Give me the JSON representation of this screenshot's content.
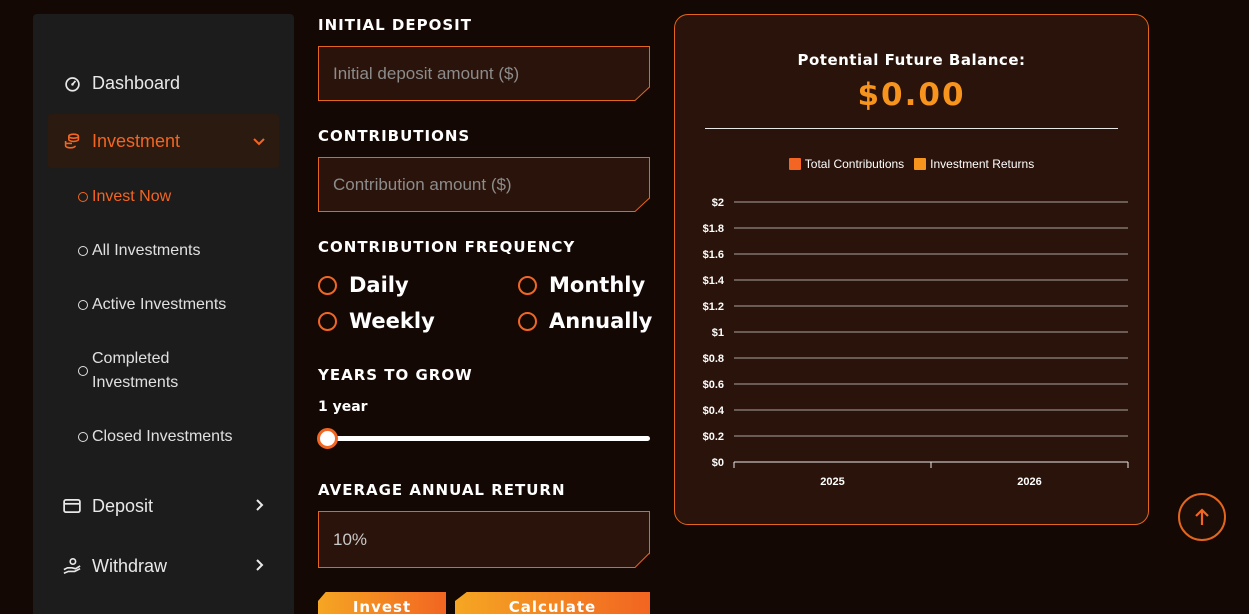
{
  "sidebar": {
    "items": [
      {
        "label": "Dashboard",
        "icon": "gauge-icon"
      },
      {
        "label": "Investment",
        "icon": "coins-icon",
        "active": true,
        "expanded": true
      },
      {
        "label": "Deposit",
        "icon": "card-icon"
      },
      {
        "label": "Withdraw",
        "icon": "withdraw-icon"
      }
    ],
    "sub_items": [
      {
        "label": "Invest Now",
        "active": true
      },
      {
        "label": "All Investments"
      },
      {
        "label": "Active Investments"
      },
      {
        "label": "Completed Investments"
      },
      {
        "label": "Closed Investments"
      }
    ]
  },
  "form": {
    "initial_deposit": {
      "label": "INITIAL DEPOSIT",
      "placeholder": "Initial deposit amount ($)",
      "value": ""
    },
    "contributions": {
      "label": "CONTRIBUTIONS",
      "placeholder": "Contribution amount ($)",
      "value": ""
    },
    "frequency": {
      "label": "CONTRIBUTION FREQUENCY",
      "options": [
        "Daily",
        "Monthly",
        "Weekly",
        "Annually"
      ]
    },
    "years": {
      "label": "YEARS TO GROW",
      "value_text": "1 year",
      "value": 1
    },
    "annual_return": {
      "label": "AVERAGE ANNUAL RETURN",
      "value": "10%"
    },
    "buttons": {
      "invest": "Invest",
      "calculate": "Calculate"
    }
  },
  "result": {
    "title": "Potential Future Balance:",
    "value": "$0.00"
  },
  "colors": {
    "accent": "#f26522",
    "accent2": "#f7941d",
    "background": "#140804",
    "panel": "#2a130a"
  },
  "chart_data": {
    "type": "bar",
    "categories": [
      "2025",
      "2026"
    ],
    "series": [
      {
        "name": "Total Contributions",
        "values": [
          0,
          0
        ],
        "color": "#f26522"
      },
      {
        "name": "Investment Returns",
        "values": [
          0,
          0
        ],
        "color": "#f7941d"
      }
    ],
    "y_ticks": [
      "$0",
      "$0.2",
      "$0.4",
      "$0.6",
      "$0.8",
      "$1",
      "$1.2",
      "$1.4",
      "$1.6",
      "$1.8",
      "$2"
    ],
    "ylim": [
      0,
      2
    ],
    "grid": true,
    "legend": "top"
  }
}
